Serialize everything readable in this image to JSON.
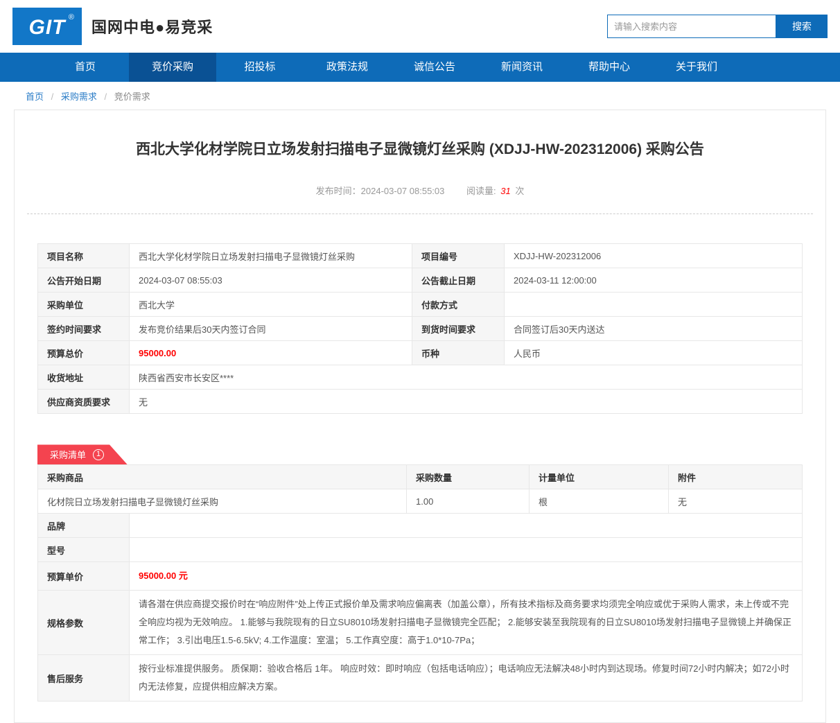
{
  "colors": {
    "brand-blue": "#1277c8",
    "nav-blue": "#0e6bb8",
    "nav-active-blue": "#0a5194",
    "link-blue": "#2a7cc7",
    "accent-red": "#ff0000",
    "badge-red": "#f4434f",
    "border-gray": "#e7e7e7",
    "label-bg": "#f6f6f6"
  },
  "header": {
    "logo_text": "GIT",
    "logo_reg": "®",
    "site_title": "国网中电●易竞采",
    "search": {
      "placeholder": "请输入搜索内容",
      "button_label": "搜索"
    }
  },
  "nav": {
    "items": [
      {
        "label": "首页",
        "active": false
      },
      {
        "label": "竞价采购",
        "active": true
      },
      {
        "label": "招投标",
        "active": false
      },
      {
        "label": "政策法规",
        "active": false
      },
      {
        "label": "诚信公告",
        "active": false
      },
      {
        "label": "新闻资讯",
        "active": false
      },
      {
        "label": "帮助中心",
        "active": false
      },
      {
        "label": "关于我们",
        "active": false
      }
    ]
  },
  "breadcrumb": {
    "separator": "/",
    "items": [
      "首页",
      "采购需求",
      "竞价需求"
    ]
  },
  "article": {
    "title": "西北大学化材学院日立场发射扫描电子显微镜灯丝采购 (XDJJ-HW-202312006) 采购公告",
    "publish_label": "发布时间：",
    "publish_time": "2024-03-07 08:55:03",
    "views_label": "阅读量:",
    "views_count": "31",
    "views_unit": "次"
  },
  "info_table": {
    "rows": [
      {
        "l1": "项目名称",
        "v1": "西北大学化材学院日立场发射扫描电子显微镜灯丝采购",
        "l2": "项目编号",
        "v2": "XDJJ-HW-202312006"
      },
      {
        "l1": "公告开始日期",
        "v1": "2024-03-07 08:55:03",
        "l2": "公告截止日期",
        "v2": "2024-03-11 12:00:00"
      },
      {
        "l1": "采购单位",
        "v1": "西北大学",
        "l2": "付款方式",
        "v2": ""
      },
      {
        "l1": "签约时间要求",
        "v1": "发布竞价结果后30天内签订合同",
        "l2": "到货时间要求",
        "v2": "合同签订后30天内送达"
      },
      {
        "l1": "预算总价",
        "v1": "95000.00",
        "l2": "币种",
        "v2": "人民币"
      },
      {
        "l1": "收货地址",
        "v1": "陕西省西安市长安区****"
      },
      {
        "l1": "供应商资质要求",
        "v1": "无"
      }
    ]
  },
  "list_section": {
    "badge_label": "采购清单",
    "badge_count": "1",
    "headers": [
      "采购商品",
      "采购数量",
      "计量单位",
      "附件"
    ],
    "product_row": {
      "name": "化材院日立场发射扫描电子显微镜灯丝采购",
      "quantity": "1.00",
      "unit": "根",
      "attachment": "无"
    },
    "detail_rows": [
      {
        "label": "品牌",
        "value": ""
      },
      {
        "label": "型号",
        "value": ""
      },
      {
        "label": "预算单价",
        "value": "95000.00 元"
      },
      {
        "label": "规格参数",
        "value": "请各潜在供应商提交报价时在“响应附件”处上传正式报价单及需求响应偏离表（加盖公章），所有技术指标及商务要求均须完全响应或优于采购人需求，未上传或不完全响应均视为无效响应。 1.能够与我院现有的日立SU8010场发射扫描电子显微镜完全匹配； 2.能够安装至我院现有的日立SU8010场发射扫描电子显微镜上并确保正常工作； 3.引出电压1.5-6.5kV; 4.工作温度：室温； 5.工作真空度：高于1.0*10-7Pa；"
      },
      {
        "label": "售后服务",
        "value": "按行业标准提供服务。 质保期：验收合格后 1年。 响应时效：即时响应（包括电话响应）；电话响应无法解决48小时内到达现场。修复时间72小时内解决；如72小时内无法修复，应提供相应解决方案。"
      }
    ]
  }
}
